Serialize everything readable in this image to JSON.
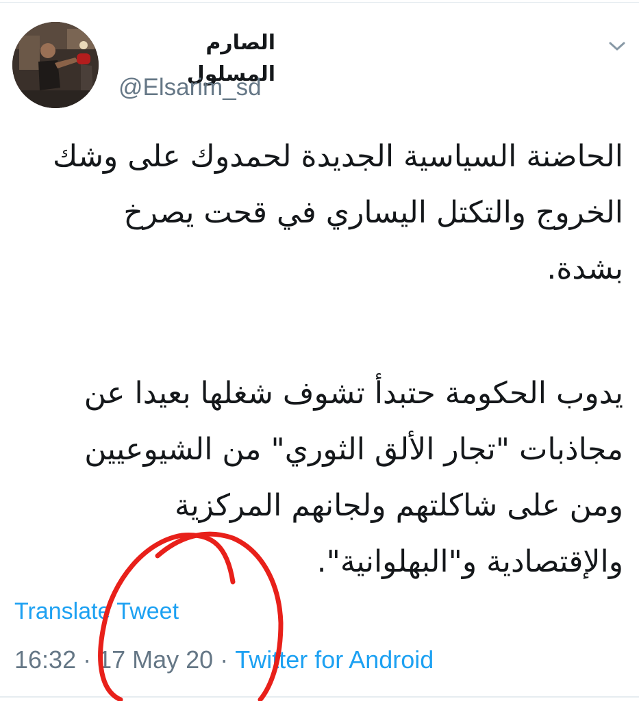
{
  "tweet": {
    "author": {
      "display_name": "الصارم المسلول",
      "handle": "@Elsarim_sd"
    },
    "paragraphs": [
      "الحاضنة السياسية الجديدة لحمدوك على وشك الخروج والتكتل اليساري في قحت يصرخ بشدة.",
      "يدوب الحكومة حتبدأ تشوف شغلها بعيدا عن مجاذبات \"تجار الألق الثوري\" من الشيوعيين ومن على شاكلتهم ولجانهم المركزية والإقتصادية و\"البهلوانية\"."
    ],
    "translate_label": "Translate Tweet",
    "time": "16:32",
    "date": "17 May 20",
    "separator": "·",
    "source": "Twitter for Android"
  },
  "icons": {
    "menu": "chevron-down-icon"
  },
  "colors": {
    "link": "#1da1f2",
    "secondary_text": "#657786",
    "annotation": "#e8201a"
  }
}
